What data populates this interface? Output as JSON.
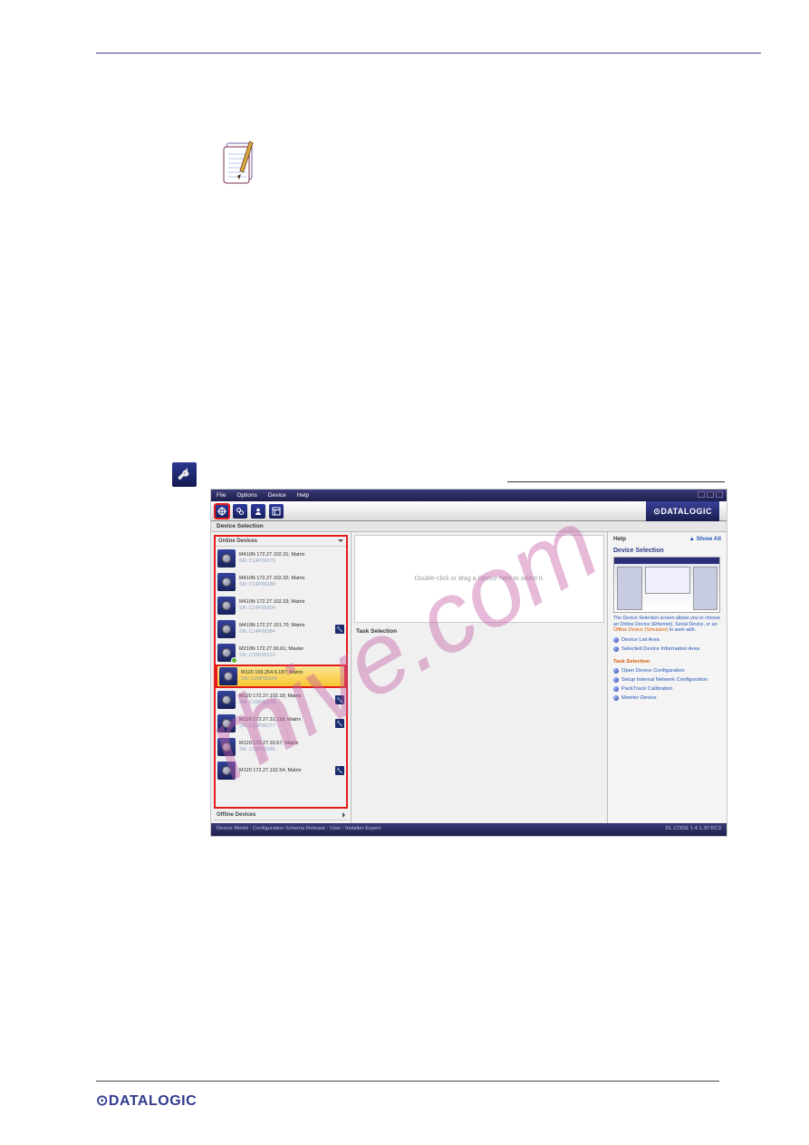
{
  "menubar": {
    "file": "File",
    "options": "Options",
    "device": "Device",
    "help": "Help"
  },
  "toolbar": {
    "brand": "⊙DATALOGIC"
  },
  "panel_title": "Device Selection",
  "list_header_online": "Online Devices",
  "list_header_offline": "Offline Devices",
  "devices": [
    {
      "title": "M410N 172.27.102.31; Matrix",
      "sn": "SN: C14P00275",
      "wrench": false,
      "badge": false,
      "hl": false
    },
    {
      "title": "M410N 172.27.102.32; Matrix",
      "sn": "SN: C14P00288",
      "wrench": false,
      "badge": false,
      "hl": false
    },
    {
      "title": "M410N 172.27.102.33; Matrix",
      "sn": "SN: C14P00304",
      "wrench": false,
      "badge": false,
      "hl": false
    },
    {
      "title": "M410N 172.27.101.70; Matrix",
      "sn": "SN: C14P00384",
      "wrench": true,
      "badge": false,
      "hl": false
    },
    {
      "title": "M210N 172.27.30.61; Master",
      "sn": "SN: C15P00212",
      "wrench": false,
      "badge": true,
      "hl": false
    },
    {
      "title": "M120 169.254.6.187; Matrix",
      "sn": "SN: C16P00104",
      "wrench": false,
      "badge": false,
      "hl": true
    },
    {
      "title": "M120 172.27.102.18; Matrix",
      "sn": "SN: C16P0017A",
      "wrench": true,
      "badge": false,
      "hl": false
    },
    {
      "title": "M120 172.27.31.118; Matrix",
      "sn": "SN: C16P00177",
      "wrench": true,
      "badge": false,
      "hl": false
    },
    {
      "title": "M120 172.27.30.67; Matrix",
      "sn": "SN: C16P00185",
      "wrench": false,
      "badge": false,
      "hl": false
    },
    {
      "title": "M120 172.27.102.54; Matrix",
      "sn": "",
      "wrench": true,
      "badge": false,
      "hl": false
    }
  ],
  "drop_prompt": "Double-click or drag a Device here to select it.",
  "task_selection": "Task Selection",
  "help": {
    "header": "Help",
    "show_all": "▲ Show All",
    "title": "Device Selection",
    "desc_pre": "The Device Selection screen allows you to choose an Online Device (Ethernet), Serial Device, or an ",
    "desc_orng": "Offline Device (Simulator)",
    "desc_post": " to work with.",
    "links_a": [
      "Device List Area",
      "Selected Device Information Area"
    ],
    "sec2": "Task Selection",
    "links_b": [
      "Open Device Configuration",
      "Setup Internal Network Configuration",
      "PackTrack Calibration",
      "Monitor Device"
    ]
  },
  "status": {
    "left": "Device Model :   Configuration Schema Release :    User : Installer-Expert",
    "right": "DL.CODE 1.4.1.30 RC3"
  },
  "footer": {
    "logo": "⊙DATALOGIC"
  }
}
